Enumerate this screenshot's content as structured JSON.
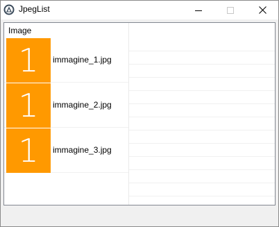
{
  "window": {
    "title": "JpegList"
  },
  "listview": {
    "column_header": "Image",
    "rows": [
      {
        "thumb_text": "1",
        "filename": "immagine_1.jpg"
      },
      {
        "thumb_text": "1",
        "filename": "immagine_2.jpg"
      },
      {
        "thumb_text": "1",
        "filename": "immagine_3.jpg"
      }
    ]
  },
  "colors": {
    "thumb_bg": "#ff9900"
  },
  "icons": {
    "app": "app-icon",
    "minimize": "minimize-icon",
    "maximize": "maximize-icon",
    "close": "close-icon"
  }
}
